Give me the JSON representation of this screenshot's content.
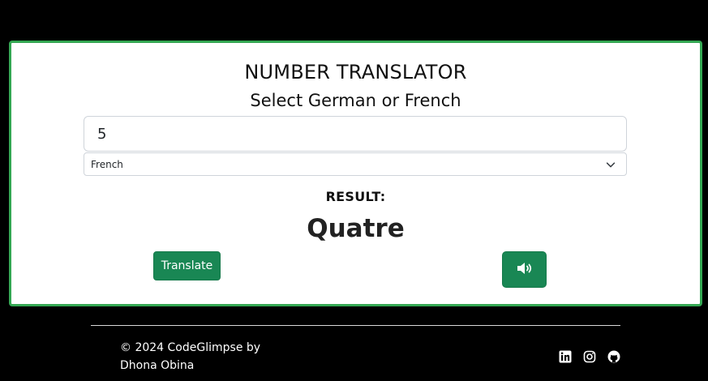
{
  "translator": {
    "title": "NUMBER TRANSLATOR",
    "subtitle": "Select German or French",
    "number_value": "5",
    "selected_language": "French",
    "result_label": "RESULT:",
    "result_value": "Quatre",
    "translate_button_label": "Translate"
  },
  "icons": {
    "select_chevron": "chevron-down-icon",
    "speak": "speaker-volume-icon",
    "social": [
      "linkedin-icon",
      "instagram-icon",
      "github-icon"
    ]
  },
  "footer": {
    "copyright_line1": "© 2024 CodeGlimpse by",
    "copyright_line2": "Dhona Obina"
  },
  "colors": {
    "background": "#000000",
    "card_border": "#34a853",
    "button": "#198754"
  }
}
